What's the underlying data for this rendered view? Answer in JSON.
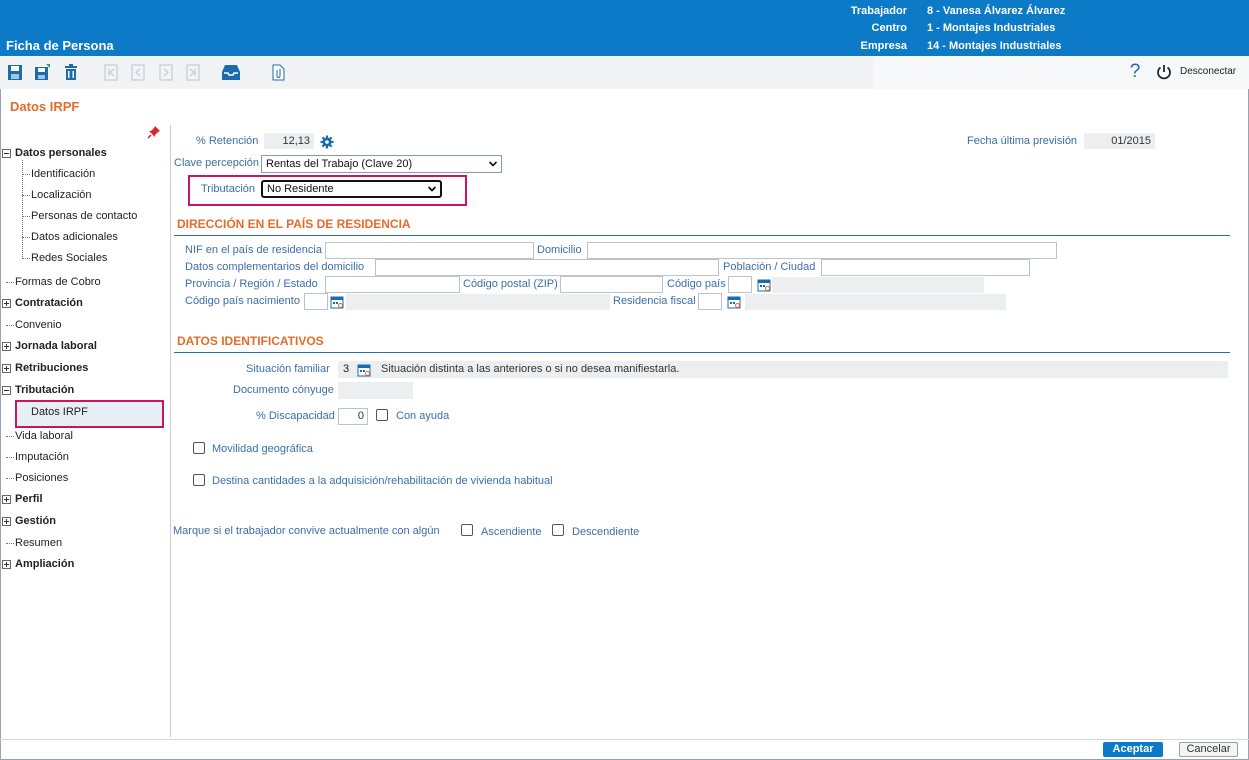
{
  "header": {
    "app_title": "Ficha de Persona",
    "rows": [
      {
        "label": "Trabajador",
        "value": "8 - Vanesa Álvarez Álvarez"
      },
      {
        "label": "Centro",
        "value": "1 - Montajes Industriales"
      },
      {
        "label": "Empresa",
        "value": "14 - Montajes Industriales"
      }
    ]
  },
  "toolbar": {
    "icons": [
      "save-icon",
      "save-new-icon",
      "delete-icon",
      "first-record-icon",
      "previous-record-icon",
      "next-record-icon",
      "last-record-icon",
      "inbox-icon",
      "attachment-icon",
      "help-icon",
      "power-icon"
    ],
    "disconnect_label": "Desconectar",
    "help_glyph": "?"
  },
  "page": {
    "heading": "Datos IRPF"
  },
  "sidebar": {
    "items": [
      {
        "label": "Datos personales",
        "bold": true,
        "toggle": "minus"
      },
      {
        "label": "Identificación"
      },
      {
        "label": "Localización"
      },
      {
        "label": "Personas de contacto"
      },
      {
        "label": "Datos adicionales"
      },
      {
        "label": "Redes Sociales"
      },
      {
        "label": "Formas de Cobro"
      },
      {
        "label": "Contratación",
        "bold": true,
        "toggle": "plus"
      },
      {
        "label": "Convenio"
      },
      {
        "label": "Jornada laboral",
        "bold": true,
        "toggle": "plus"
      },
      {
        "label": "Retribuciones",
        "bold": true,
        "toggle": "plus"
      },
      {
        "label": "Tributación",
        "bold": true,
        "toggle": "minus"
      },
      {
        "label": "Datos IRPF",
        "selected": true
      },
      {
        "label": "Vida laboral"
      },
      {
        "label": "Imputación"
      },
      {
        "label": "Posiciones"
      },
      {
        "label": "Perfil",
        "bold": true,
        "toggle": "plus"
      },
      {
        "label": "Gestión",
        "bold": true,
        "toggle": "plus"
      },
      {
        "label": "Resumen"
      },
      {
        "label": "Ampliación",
        "bold": true,
        "toggle": "plus"
      }
    ]
  },
  "form": {
    "retencion_label": "% Retención",
    "retencion_value": "12,13",
    "fecha_label": "Fecha última previsión",
    "fecha_value": "01/2015",
    "clave_label": "Clave percepción",
    "clave_value": "Rentas del Trabajo (Clave 20)",
    "tributacion_label": "Tributación",
    "tributacion_value": "No Residente",
    "section_residencia": "DIRECCIÓN EN EL PAÍS DE RESIDENCIA",
    "nif_label": "NIF en el país de residencia",
    "nif_value": "",
    "domicilio_label": "Domicilio",
    "domicilio_value": "",
    "complementarios_label": "Datos complementarios del domicilio",
    "complementarios_value": "",
    "poblacion_label": "Población / Ciudad",
    "poblacion_value": "",
    "provincia_label": "Provincia / Región / Estado",
    "provincia_value": "",
    "cp_label": "Código postal (ZIP)",
    "cp_value": "",
    "pais_label": "Código país",
    "pais_value": "",
    "pais_nac_label": "Código país nacimiento",
    "pais_nac_value": "",
    "residencia_fiscal_label": "Residencia fiscal",
    "residencia_fiscal_value": "",
    "section_identificativos": "DATOS IDENTIFICATIVOS",
    "situacion_label": "Situación familiar",
    "situacion_code": "3",
    "situacion_desc": "Situación distinta a las anteriores o si no desea manifiestarla.",
    "documento_label": "Documento cónyuge",
    "documento_value": "",
    "discapacidad_label": "% Discapacidad",
    "discapacidad_value": "0",
    "con_ayuda_label": "Con ayuda",
    "movilidad_label": "Movilidad geográfica",
    "vivienda_label": "Destina cantidades a la adquisición/rehabilitación de vivienda habitual",
    "convive_label": "Marque si el trabajador convive actualmente con algún",
    "ascendiente_label": "Ascendiente",
    "descendiente_label": "Descendiente"
  },
  "footer": {
    "accept_label": "Aceptar",
    "cancel_label": "Cancelar"
  },
  "colors": {
    "brand": "#0c7ac7",
    "accent": "#e46c2a",
    "highlight": "#c8175d",
    "label": "#3c6ea8"
  }
}
